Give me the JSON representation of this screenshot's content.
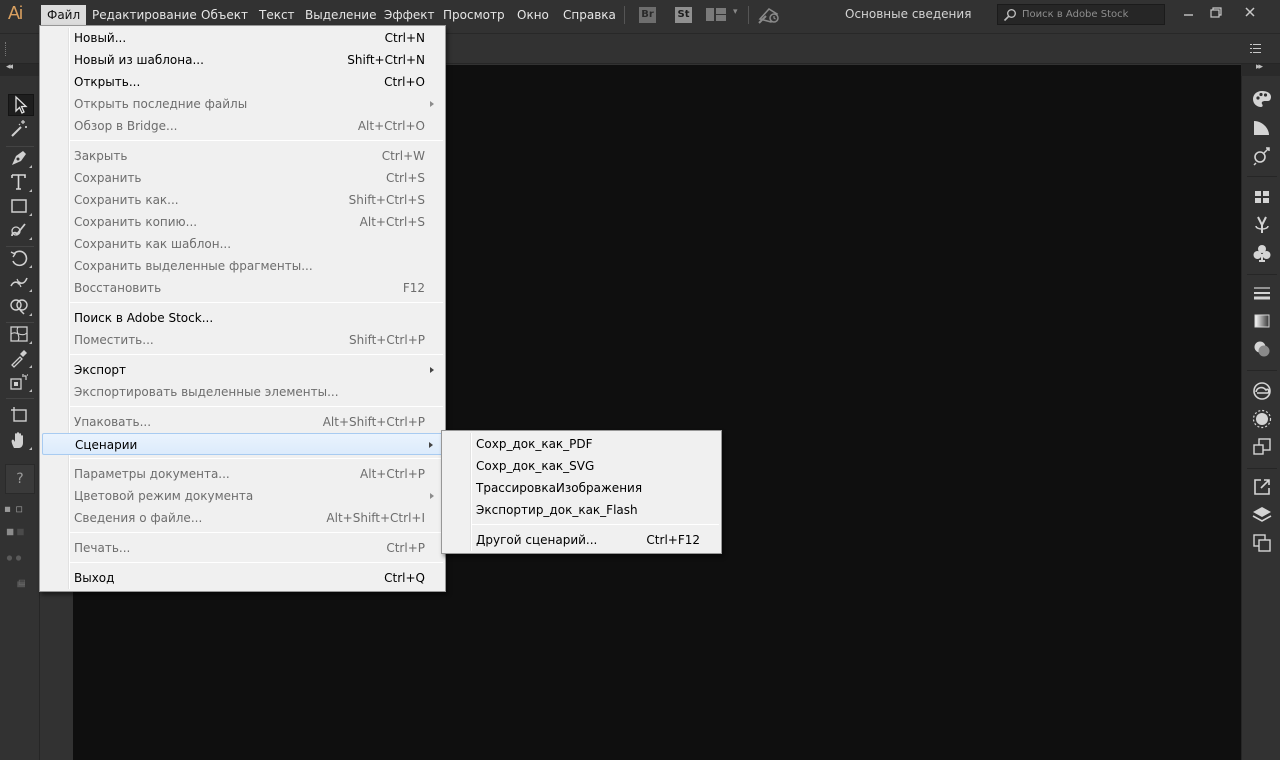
{
  "app": {
    "logo": "Ai"
  },
  "menubar": {
    "items": [
      {
        "label": "Файл",
        "active": true
      },
      {
        "label": "Редактирование"
      },
      {
        "label": "Объект"
      },
      {
        "label": "Текст"
      },
      {
        "label": "Выделение"
      },
      {
        "label": "Эффект"
      },
      {
        "label": "Просмотр"
      },
      {
        "label": "Окно"
      },
      {
        "label": "Справка"
      }
    ],
    "bridge_label": "Br",
    "stock_label": "St",
    "workspace": "Основные сведения",
    "search_placeholder": "Поиск в Adobe Stock"
  },
  "file_menu": {
    "items": [
      {
        "label": "Новый...",
        "shortcut": "Ctrl+N",
        "enabled": true
      },
      {
        "label": "Новый из шаблона...",
        "shortcut": "Shift+Ctrl+N",
        "enabled": true
      },
      {
        "label": "Открыть...",
        "shortcut": "Ctrl+O",
        "enabled": true
      },
      {
        "label": "Открыть последние файлы",
        "shortcut": "",
        "enabled": false,
        "submenu": true
      },
      {
        "label": "Обзор в Bridge...",
        "shortcut": "Alt+Ctrl+O",
        "enabled": false
      },
      {
        "separator": true
      },
      {
        "label": "Закрыть",
        "shortcut": "Ctrl+W",
        "enabled": false
      },
      {
        "label": "Сохранить",
        "shortcut": "Ctrl+S",
        "enabled": false
      },
      {
        "label": "Сохранить как...",
        "shortcut": "Shift+Ctrl+S",
        "enabled": false
      },
      {
        "label": "Сохранить копию...",
        "shortcut": "Alt+Ctrl+S",
        "enabled": false
      },
      {
        "label": "Сохранить как шаблон...",
        "shortcut": "",
        "enabled": false
      },
      {
        "label": "Сохранить выделенные фрагменты...",
        "shortcut": "",
        "enabled": false
      },
      {
        "label": "Восстановить",
        "shortcut": "F12",
        "enabled": false
      },
      {
        "separator": true
      },
      {
        "label": "Поиск в Adobe Stock...",
        "shortcut": "",
        "enabled": true
      },
      {
        "label": "Поместить...",
        "shortcut": "Shift+Ctrl+P",
        "enabled": false
      },
      {
        "separator": true
      },
      {
        "label": "Экспорт",
        "shortcut": "",
        "enabled": true,
        "submenu": true
      },
      {
        "label": "Экспортировать выделенные элементы...",
        "shortcut": "",
        "enabled": false
      },
      {
        "separator": true
      },
      {
        "label": "Упаковать...",
        "shortcut": "Alt+Shift+Ctrl+P",
        "enabled": false
      },
      {
        "label": "Сценарии",
        "shortcut": "",
        "enabled": true,
        "submenu": true,
        "highlighted": true
      },
      {
        "separator": true
      },
      {
        "label": "Параметры документа...",
        "shortcut": "Alt+Ctrl+P",
        "enabled": false
      },
      {
        "label": "Цветовой режим документа",
        "shortcut": "",
        "enabled": false,
        "submenu": true
      },
      {
        "label": "Сведения о файле...",
        "shortcut": "Alt+Shift+Ctrl+I",
        "enabled": false
      },
      {
        "separator": true
      },
      {
        "label": "Печать...",
        "shortcut": "Ctrl+P",
        "enabled": false
      },
      {
        "separator": true
      },
      {
        "label": "Выход",
        "shortcut": "Ctrl+Q",
        "enabled": true
      }
    ]
  },
  "scripts_menu": {
    "items": [
      {
        "label": "Сохр_док_как_PDF",
        "shortcut": ""
      },
      {
        "label": "Сохр_док_как_SVG",
        "shortcut": ""
      },
      {
        "label": "ТрассировкаИзображения",
        "shortcut": ""
      },
      {
        "label": "Экспортир_док_как_Flash",
        "shortcut": ""
      },
      {
        "separator": true
      },
      {
        "label": "Другой сценарий...",
        "shortcut": "Ctrl+F12"
      }
    ]
  },
  "colors": {
    "chrome": "#323232",
    "canvas": "#0f0f0f",
    "menu_bg": "#f0f0f0",
    "logo": "#d9a060",
    "highlight": "#dcebfc"
  }
}
